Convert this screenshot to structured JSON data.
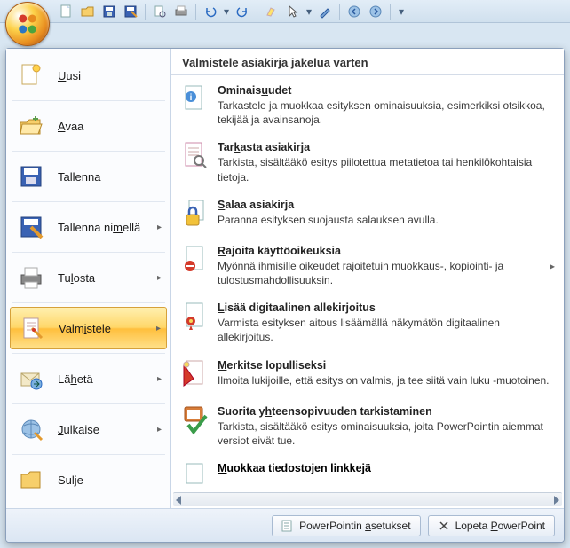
{
  "left_menu": {
    "new": "Uusi",
    "open": "Avaa",
    "save": "Tallenna",
    "save_as": "Tallenna nimellä",
    "print": "Tulosta",
    "prepare": "Valmistele",
    "send": "Lähetä",
    "publish": "Julkaise",
    "close": "Sulje"
  },
  "right": {
    "header": "Valmistele asiakirja jakelua varten",
    "items": [
      {
        "title": "Ominaisuudet",
        "desc": "Tarkastele ja muokkaa esityksen ominaisuuksia, esimerkiksi otsikkoa, tekijää ja avainsanoja."
      },
      {
        "title": "Tarkasta asiakirja",
        "desc": "Tarkista, sisältääkö esitys piilotettua metatietoa tai henkilökohtaisia tietoja."
      },
      {
        "title": "Salaa asiakirja",
        "desc": "Paranna esityksen suojausta salauksen avulla."
      },
      {
        "title": "Rajoita käyttöoikeuksia",
        "desc": "Myönnä ihmisille oikeudet rajoitetuin muokkaus-, kopiointi- ja tulostusmahdollisuuksin."
      },
      {
        "title": "Lisää digitaalinen allekirjoitus",
        "desc": "Varmista esityksen aitous lisäämällä näkymätön digitaalinen allekirjoitus."
      },
      {
        "title": "Merkitse lopulliseksi",
        "desc": "Ilmoita lukijoille, että esitys on valmis, ja tee siitä vain luku -muotoinen."
      },
      {
        "title": "Suorita yhteensopivuuden tarkistaminen",
        "desc": "Tarkista, sisältääkö esitys ominaisuuksia, joita PowerPointin aiemmat versiot eivät tue."
      }
    ],
    "last_title": "Muokkaa tiedostojen linkkejä"
  },
  "footer": {
    "options": "PowerPointin asetukset",
    "exit": "Lopeta PowerPoint"
  }
}
